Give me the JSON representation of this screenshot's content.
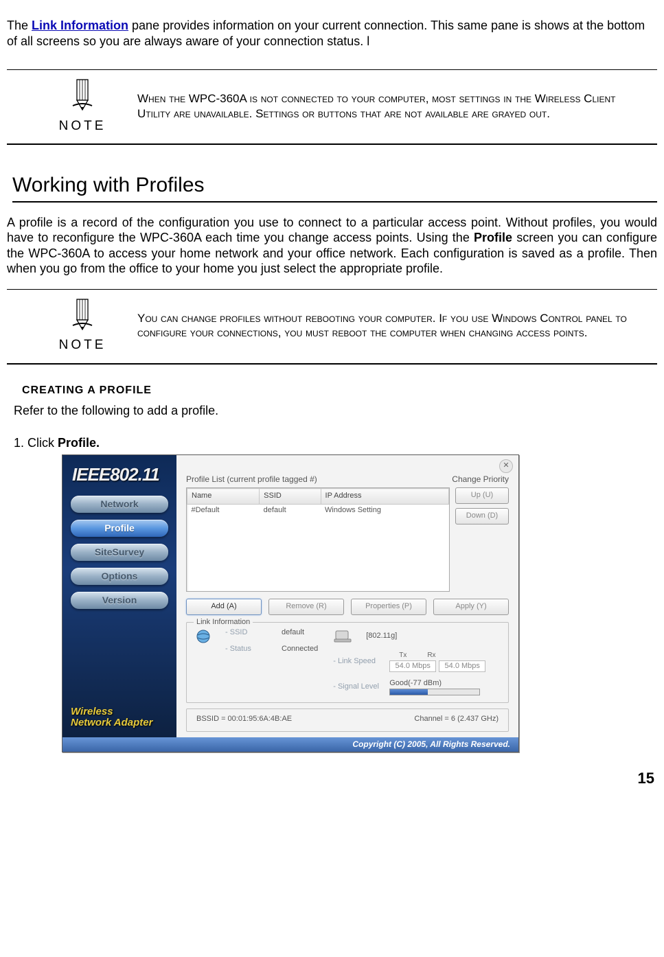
{
  "intro_pre": "The ",
  "intro_link": "Link Information",
  "intro_post": " pane provides information on your current connection. This same pane is shows at the bottom of all screens so you are always aware of your connection status. l",
  "note_label": "NOTE",
  "note1": "When the WPC-360A is not connected to your computer, most settings in the Wireless Client Utility are unavailable. Settings or buttons that are not available are grayed out.",
  "section_title": "Working with Profiles",
  "profiles_para_a": "A profile is a record of the configuration you use to connect to a particular access point. Without profiles, you would have to reconfigure the WPC-360A each time you change access points. Using the ",
  "profiles_para_bold": "Profile",
  "profiles_para_b": " screen you can configure the WPC-360A to access your home network and your office network. Each configuration is saved as a profile. Then when you go from the office to your home you just select the appropriate profile.",
  "note2": "You can change profiles without rebooting your computer. If you use Windows Control panel to configure your connections, you must reboot the computer when changing access points.",
  "subhead": "CREATING A PROFILE",
  "subintro": "Refer to the following to add a profile.",
  "step1_a": "Click ",
  "step1_bold": "Profile.",
  "page_number": "15",
  "app": {
    "ieee": "IEEE802.11",
    "nav": [
      "Network",
      "Profile",
      "SiteSurvey",
      "Options",
      "Version"
    ],
    "wna1": "Wireless",
    "wna2": "Network Adapter",
    "plist_caption": "Profile List (current profile tagged #)",
    "change_priority": "Change Priority",
    "cols": {
      "name": "Name",
      "ssid": "SSID",
      "ip": "IP Address"
    },
    "row": {
      "name": "#Default",
      "ssid": "default",
      "ip": "Windows Setting"
    },
    "up": "Up (U)",
    "down": "Down (D)",
    "add": "Add (A)",
    "remove": "Remove (R)",
    "properties": "Properties (P)",
    "apply": "Apply (Y)",
    "link_info": "Link Information",
    "ssid_label": "SSID",
    "ssid_val": "default",
    "status_label": "Status",
    "status_val": "Connected",
    "mode": "[802.11g]",
    "linkspeed_label": "Link Speed",
    "tx": "Tx",
    "rx": "Rx",
    "tx_val": "54.0 Mbps",
    "rx_val": "54.0 Mbps",
    "signal_label": "Signal Level",
    "signal_val": "Good(-77 dBm)",
    "bssid": "BSSID = 00:01:95:6A:4B:AE",
    "channel": "Channel = 6 (2.437 GHz)",
    "copyright": "Copyright (C) 2005, All Rights Reserved."
  }
}
